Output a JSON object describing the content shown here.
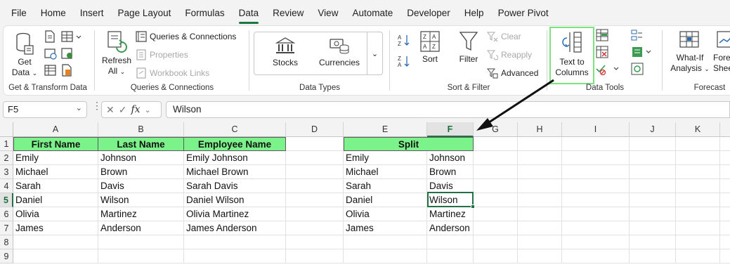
{
  "menu": {
    "tabs": [
      "File",
      "Home",
      "Insert",
      "Page Layout",
      "Formulas",
      "Data",
      "Review",
      "View",
      "Automate",
      "Developer",
      "Help",
      "Power Pivot"
    ],
    "active": "Data"
  },
  "ribbon": {
    "get_transform": {
      "get_data": "Get",
      "get_data_2": "Data",
      "label": "Get & Transform Data"
    },
    "queries": {
      "refresh": "Refresh",
      "refresh_2": "All",
      "queries_connections": "Queries & Connections",
      "properties": "Properties",
      "workbook_links": "Workbook Links",
      "label": "Queries & Connections"
    },
    "data_types": {
      "stocks": "Stocks",
      "currencies": "Currencies",
      "label": "Data Types"
    },
    "sort_filter": {
      "sort": "Sort",
      "filter": "Filter",
      "clear": "Clear",
      "reapply": "Reapply",
      "advanced": "Advanced",
      "label": "Sort & Filter"
    },
    "data_tools": {
      "text_to_columns": "Text to",
      "text_to_columns_2": "Columns",
      "label": "Data Tools"
    },
    "forecast": {
      "what_if": "What-If",
      "what_if_2": "Analysis",
      "forecast_sheet": "Forecast",
      "forecast_sheet_2": "Sheet",
      "label": "Forecast"
    },
    "highlight_color": "#7de27f"
  },
  "formula_bar": {
    "name_box": "F5",
    "formula": "Wilson"
  },
  "grid": {
    "columns": [
      "A",
      "B",
      "C",
      "D",
      "E",
      "F",
      "G",
      "H",
      "I",
      "J",
      "K"
    ],
    "rows": [
      "1",
      "2",
      "3",
      "4",
      "5",
      "6",
      "7",
      "8",
      "9"
    ],
    "selected_col": "F",
    "selected_row": "5",
    "header_fill": "#7cf28a",
    "headers": {
      "first_name": "First Name",
      "last_name": "Last Name",
      "employee_name": "Employee Name",
      "split": "Split"
    },
    "records": [
      {
        "first": "Emily",
        "last": "Johnson",
        "full": "Emily Johnson",
        "split_first": "Emily",
        "split_last": "Johnson"
      },
      {
        "first": "Michael",
        "last": "Brown",
        "full": "Michael Brown",
        "split_first": "Michael",
        "split_last": "Brown"
      },
      {
        "first": "Sarah",
        "last": "Davis",
        "full": "Sarah Davis",
        "split_first": "Sarah",
        "split_last": "Davis"
      },
      {
        "first": "Daniel",
        "last": "Wilson",
        "full": "Daniel Wilson",
        "split_first": "Daniel",
        "split_last": "Wilson"
      },
      {
        "first": "Olivia",
        "last": "Martinez",
        "full": "Olivia Martinez",
        "split_first": "Olivia",
        "split_last": "Martinez"
      },
      {
        "first": "James",
        "last": "Anderson",
        "full": "James Anderson",
        "split_first": "James",
        "split_last": "Anderson"
      }
    ]
  }
}
